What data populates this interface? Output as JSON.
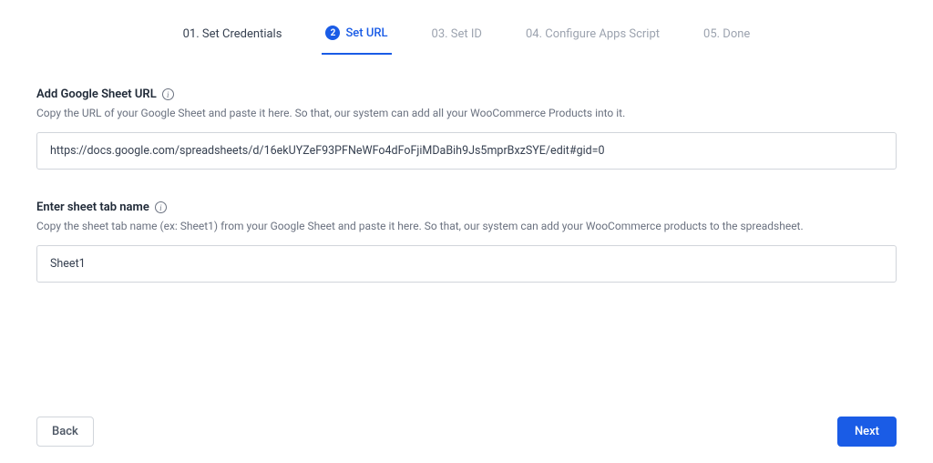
{
  "stepper": {
    "steps": [
      {
        "label": "01. Set Credentials",
        "state": "completed"
      },
      {
        "label": "Set URL",
        "badge": "2",
        "state": "active"
      },
      {
        "label": "03. Set ID",
        "state": "upcoming"
      },
      {
        "label": "04. Configure Apps Script",
        "state": "upcoming"
      },
      {
        "label": "05. Done",
        "state": "upcoming"
      }
    ]
  },
  "fields": {
    "url": {
      "label": "Add Google Sheet URL",
      "description": "Copy the URL of your Google Sheet and paste it here. So that, our system can add all your WooCommerce Products into it.",
      "value": "https://docs.google.com/spreadsheets/d/16ekUYZeF93PFNeWFo4dFoFjiMDaBih9Js5mprBxzSYE/edit#gid=0"
    },
    "tab": {
      "label": "Enter sheet tab name",
      "description": "Copy the sheet tab name (ex: Sheet1) from your Google Sheet and paste it here. So that, our system can add your WooCommerce products to the spreadsheet.",
      "value": "Sheet1"
    }
  },
  "footer": {
    "back": "Back",
    "next": "Next"
  }
}
